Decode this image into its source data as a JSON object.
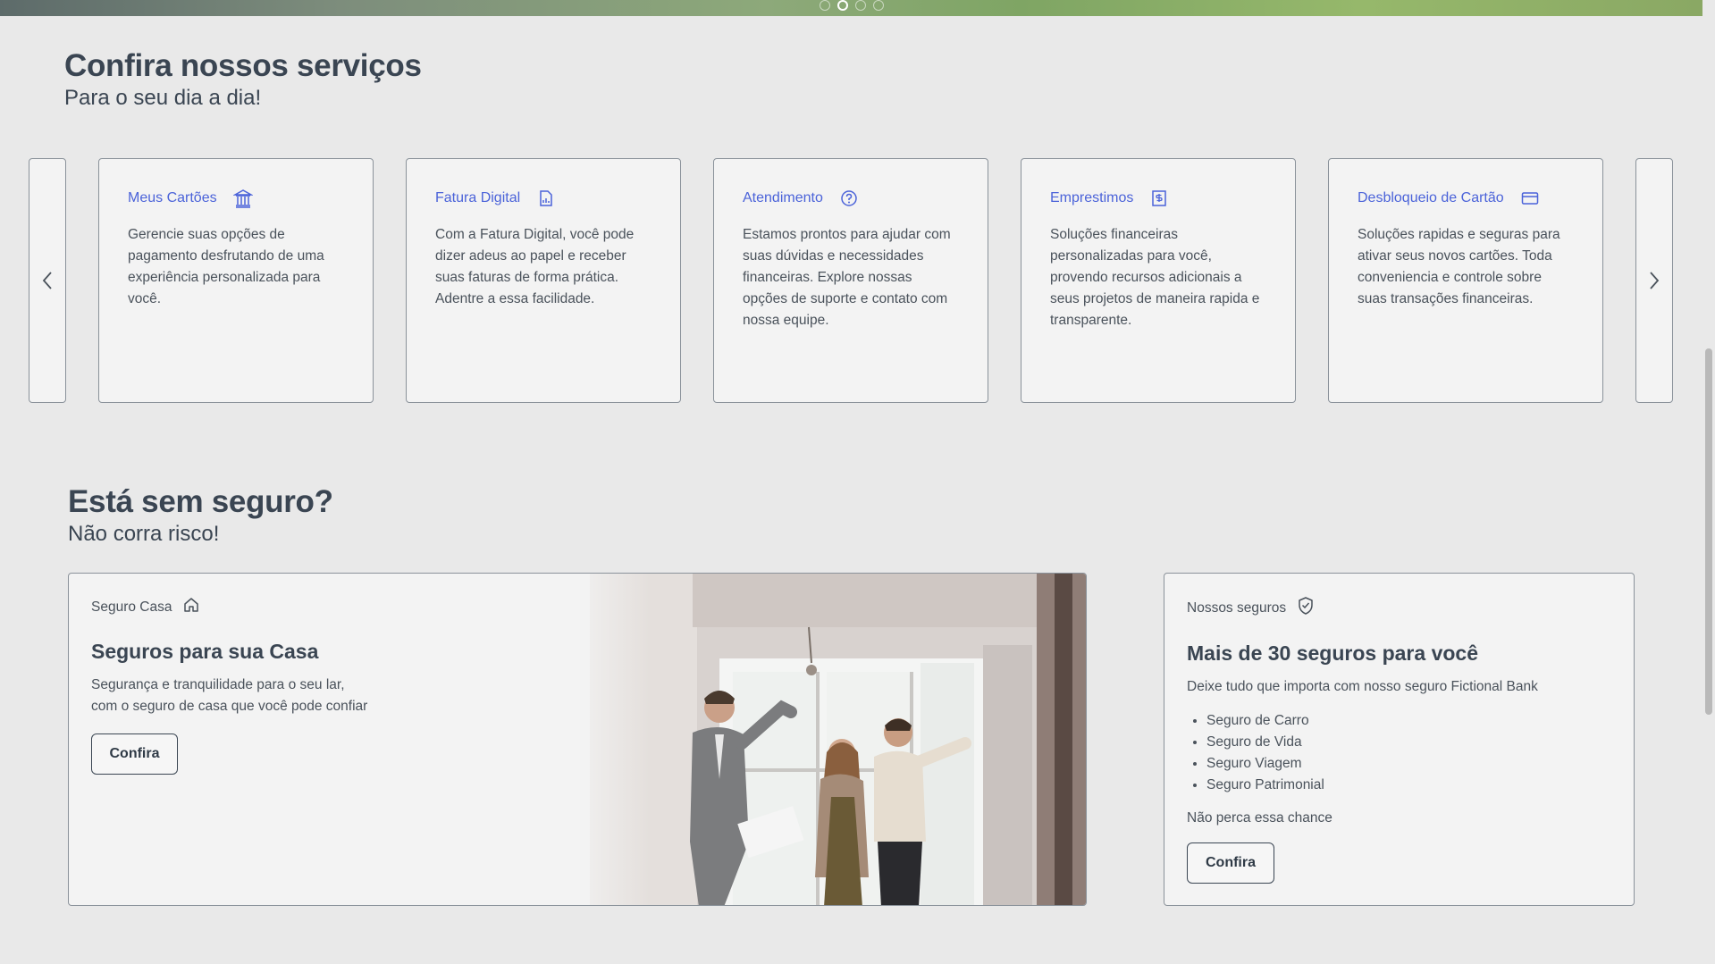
{
  "carousel": {
    "active_index": 1,
    "count": 4
  },
  "services": {
    "title": "Confira nossos serviços",
    "subtitle": "Para o seu dia a dia!",
    "cards": [
      {
        "title": "Meus Cartões",
        "icon": "bank-icon",
        "text": "Gerencie suas opções de pagamento desfrutando de uma experiência personalizada para você."
      },
      {
        "title": "Fatura Digital",
        "icon": "document-icon",
        "text": "Com a Fatura Digital, você pode dizer adeus ao papel e receber suas faturas de forma prática. Adentre a essa facilidade."
      },
      {
        "title": "Atendimento",
        "icon": "help-circle-icon",
        "text": "Estamos prontos para ajudar com suas dúvidas e necessidades financeiras. Explore nossas opções de suporte e contato com nossa equipe."
      },
      {
        "title": "Emprestimos",
        "icon": "money-bill-icon",
        "text": "Soluções financeiras personalizadas para você, provendo recursos adicionais a seus projetos de maneira rapida e transparente."
      },
      {
        "title": "Desbloqueio de Cartão",
        "icon": "credit-card-icon",
        "text": "Soluções rapidas e seguras para ativar seus novos cartões. Toda conveniencia e controle sobre suas transações financeiras."
      }
    ]
  },
  "insurance": {
    "title": "Está sem seguro?",
    "subtitle": "Não corra risco!",
    "home": {
      "label": "Seguro Casa",
      "icon": "home-icon",
      "heading": "Seguros para sua Casa",
      "line1": "Segurança e tranquilidade para o seu lar,",
      "line2": "com o seguro de casa que você pode confiar",
      "button": "Confira"
    },
    "ours": {
      "label": "Nossos seguros",
      "icon": "shield-check-icon",
      "heading": "Mais de 30 seguros para você",
      "desc": "Deixe tudo que importa com nosso seguro Fictional Bank",
      "items": [
        "Seguro de Carro",
        "Seguro de Vida",
        "Seguro Viagem",
        "Seguro Patrimonial"
      ],
      "note": "Não perca essa chance",
      "button": "Confira"
    }
  },
  "colors": {
    "accent": "#4b63d9",
    "text": "#3a4552",
    "background": "#e9e9e9"
  }
}
